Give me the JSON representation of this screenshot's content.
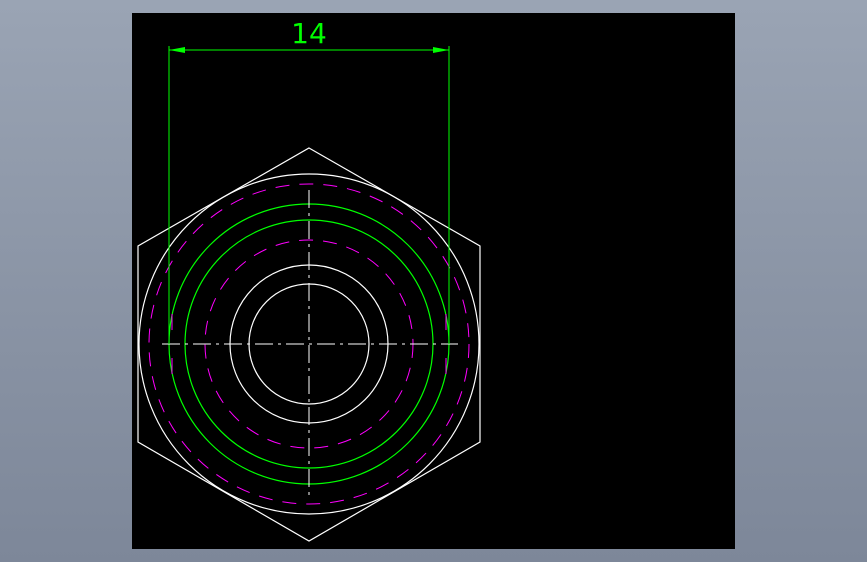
{
  "drawing": {
    "dimension": {
      "value": "14"
    },
    "colors": {
      "background": "#000000",
      "outline": "#ffffff",
      "dimension": "#00ff00",
      "hidden_lines": "#ff00ff",
      "centerlines": "#ffffff"
    }
  }
}
